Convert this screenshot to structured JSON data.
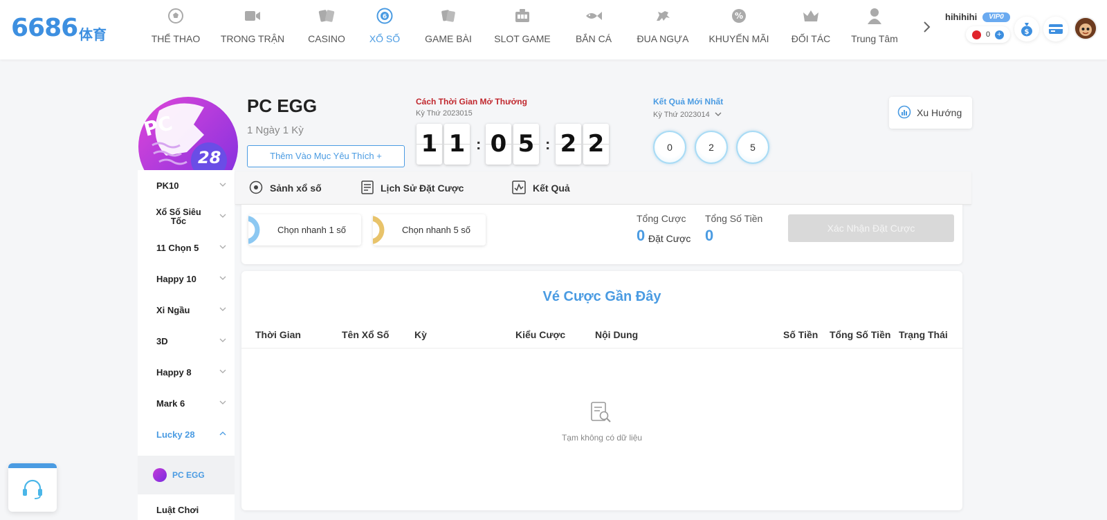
{
  "brand": {
    "number": "6686",
    "cn": "体育"
  },
  "nav": [
    {
      "label": "THỂ THAO",
      "icon": "soccer-ball-icon"
    },
    {
      "label": "TRONG TRẬN",
      "icon": "video-camera-icon"
    },
    {
      "label": "CASINO",
      "icon": "playing-cards-icon"
    },
    {
      "label": "XỔ SỐ",
      "icon": "lottery-ball-icon",
      "active": true
    },
    {
      "label": "GAME BÀI",
      "icon": "card-game-icon"
    },
    {
      "label": "SLOT GAME",
      "icon": "slot-machine-icon"
    },
    {
      "label": "BẮN CÁ",
      "icon": "fish-icon"
    },
    {
      "label": "ĐUA NGỰA",
      "icon": "horse-icon"
    },
    {
      "label": "KHUYẾN MÃI",
      "icon": "percent-badge-icon"
    },
    {
      "label": "ĐỐI TÁC",
      "icon": "crown-icon"
    },
    {
      "label": "Trung Tâm",
      "icon": "user-icon"
    }
  ],
  "user": {
    "name": "hihihihi",
    "vip": "VIP0",
    "balance": "0"
  },
  "game": {
    "title": "PC EGG",
    "frequency": "1 Ngày 1 Kỳ",
    "favorite_label": "Thêm Vào Mục Yêu Thích +",
    "logo_text": "PC",
    "logo_num": "28"
  },
  "countdown": {
    "label": "Cách Thời Gian Mở Thưởng",
    "issue": "Kỳ Thứ 2023015",
    "digits": [
      "1",
      "1",
      "0",
      "5",
      "2",
      "2"
    ]
  },
  "latest": {
    "label": "Kết Quả Mới Nhất",
    "issue": "Kỳ Thứ 2023014",
    "balls": [
      "0",
      "2",
      "5"
    ]
  },
  "trend_label": "Xu Hướng",
  "sidebar": {
    "items": [
      {
        "label": "PK10"
      },
      {
        "label": "Xổ Số Siêu Tốc"
      },
      {
        "label": "11 Chọn 5"
      },
      {
        "label": "Happy 10"
      },
      {
        "label": "Xi Ngầu"
      },
      {
        "label": "3D"
      },
      {
        "label": "Happy 8"
      },
      {
        "label": "Mark 6"
      },
      {
        "label": "Lucky 28",
        "active": true
      }
    ],
    "sub_item": "PC EGG",
    "rules": "Luật Chơi"
  },
  "tabs": [
    {
      "label": "Sảnh xổ số",
      "icon": "lottery-lobby-icon"
    },
    {
      "label": "Lịch Sử Đặt Cược",
      "icon": "document-list-icon"
    },
    {
      "label": "Kết Quả",
      "icon": "chart-check-icon"
    }
  ],
  "bet": {
    "quick1": "Chọn nhanh 1 số",
    "quick5": "Chọn nhanh 5 số",
    "total_bets_label": "Tổng Cược",
    "total_bets_value": "0",
    "total_bets_unit": "Đặt Cược",
    "total_amount_label": "Tổng Số Tiền",
    "total_amount_value": "0",
    "confirm_label": "Xác Nhận Đặt Cược"
  },
  "recent": {
    "title": "Vé Cược Gần Đây",
    "columns": [
      "Thời Gian",
      "Tên Xổ Số",
      "Kỳ",
      "Kiểu Cược",
      "Nội Dung",
      "Số Tiền",
      "Tổng Số Tiền",
      "Trạng Thái"
    ],
    "empty_text": "Tạm không có dữ liệu"
  },
  "colors": {
    "accent": "#4a9be2",
    "countdown_label": "#c0272d",
    "egg": "#b234d8"
  }
}
